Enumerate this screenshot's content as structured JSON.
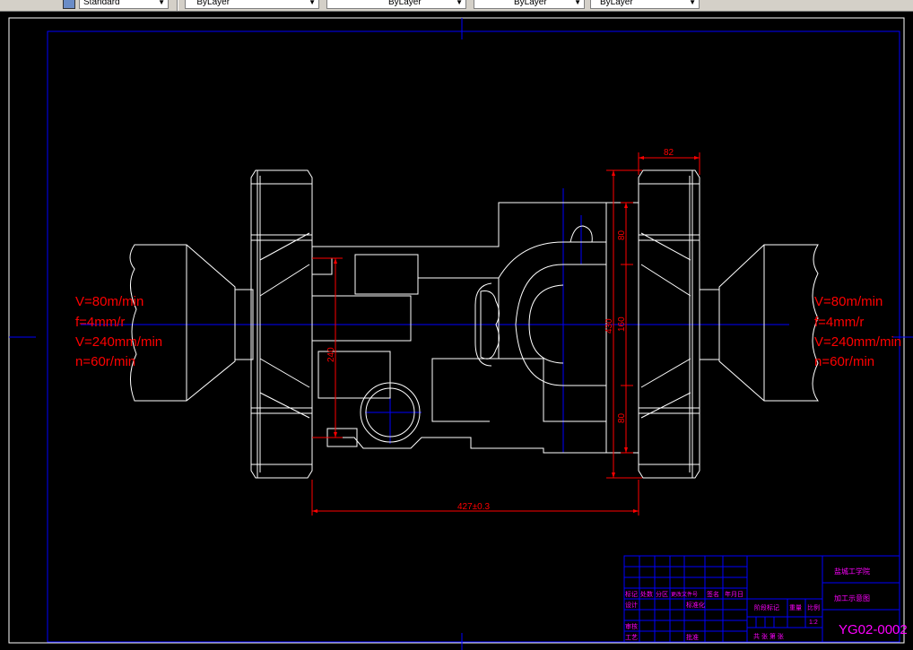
{
  "toolbar": {
    "text_style": "Standard",
    "layer": "ByLayer",
    "linetype": "ByLayer",
    "lineweight": "ByLayer",
    "plot_style": "ByLayer"
  },
  "colors": {
    "drawing_lines": "#ffffff",
    "dimensions": "#ff0000",
    "centerlines": "#0000ff",
    "title_block": "#0000ff",
    "title_block_text": "#ff00ff",
    "background": "#000000"
  },
  "drawing": {
    "params_left": [
      "V=80m/min",
      "f=4mm/r",
      "V=240mm/min",
      "n=60r/min"
    ],
    "params_right": [
      "V=80m/min",
      "f=4mm/r",
      "V=240mm/min",
      "n=60r/min"
    ],
    "dimensions": {
      "top_width": "82",
      "upper": "80",
      "total_height": "430",
      "middle": "160",
      "lower": "80",
      "left_height": "240",
      "overall_length": "427±0.3"
    }
  },
  "title_block": {
    "school": "盐城工学院",
    "drawing_title": "加工示意图",
    "drawing_number": "YG02-0002",
    "scale": "1:2",
    "labels": {
      "mark": "标记",
      "count": "处数",
      "zone": "分区",
      "change_doc": "更改文件号",
      "signature": "签名",
      "date": "年月日",
      "design": "设计",
      "standardization": "标准化",
      "review": "审核",
      "process": "工艺",
      "approve": "批准",
      "stage_mark": "阶段标记",
      "weight": "重量",
      "ratio": "比例",
      "sheet_info": "共 张 第 张"
    }
  }
}
